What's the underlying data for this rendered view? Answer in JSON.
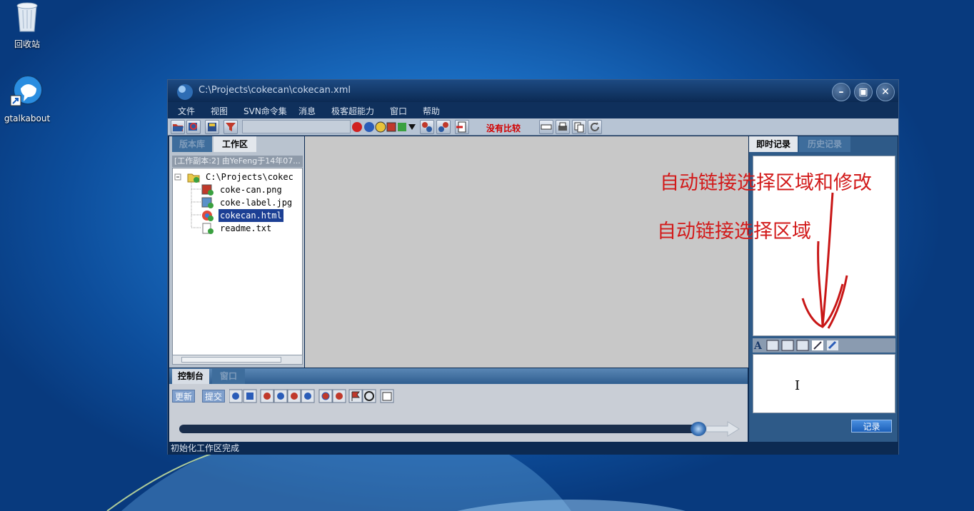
{
  "desktop": {
    "icons": [
      {
        "name": "recycle-bin",
        "label": "回收站"
      },
      {
        "name": "gtalkabout",
        "label": "gtalkabout"
      }
    ]
  },
  "window": {
    "title": "C:\\Projects\\cokecan\\cokecan.xml",
    "menu": [
      "文件",
      "视图",
      "SVN命令集",
      "消息",
      "极客超能力",
      "窗口",
      "帮助"
    ],
    "toolbar": {
      "compare_status": "没有比较",
      "icons": [
        "open-folder-icon",
        "search-icon",
        "save-icon",
        "filter-icon",
        "compare-red-icon",
        "compare-blue-icon",
        "stack-icon",
        "square-icon",
        "arrow-icon",
        "dropdown-icon",
        "split-icon",
        "merge-icon",
        "export-icon",
        "fit-width-icon",
        "print-icon",
        "copy-icon",
        "refresh-icon"
      ]
    },
    "left_pane": {
      "tabs": [
        {
          "label": "版本库",
          "active": false
        },
        {
          "label": "工作区",
          "active": true
        }
      ],
      "working_copy_info": "[工作副本:2] 由YeFeng于14年07...",
      "tree": [
        {
          "label": "C:\\Projects\\cokec",
          "type": "folder",
          "level": 0,
          "selected": false
        },
        {
          "label": "coke-can.png",
          "type": "image",
          "level": 1,
          "selected": false
        },
        {
          "label": "coke-label.jpg",
          "type": "image",
          "level": 1,
          "selected": false
        },
        {
          "label": "cokecan.html",
          "type": "html",
          "level": 1,
          "selected": true
        },
        {
          "label": "readme.txt",
          "type": "text",
          "level": 1,
          "selected": false
        }
      ]
    },
    "right_pane": {
      "tabs": [
        {
          "label": "即时记录",
          "active": true
        },
        {
          "label": "历史记录",
          "active": false
        }
      ],
      "editor_tools": [
        "font-icon",
        "image-icon",
        "camera-icon",
        "capture-icon",
        "pen-icon",
        "attach-icon"
      ],
      "record_button": "记录"
    },
    "bottom_pane": {
      "tabs": [
        {
          "label": "控制台",
          "active": true
        },
        {
          "label": "窗口",
          "active": false
        }
      ],
      "buttons": {
        "update": "更新",
        "commit": "提交"
      },
      "progress": 0.98
    },
    "status": "初始化工作区完成"
  },
  "annotations": {
    "line1": "自动链接选择区域和修改",
    "line2": "自动链接选择区域"
  }
}
